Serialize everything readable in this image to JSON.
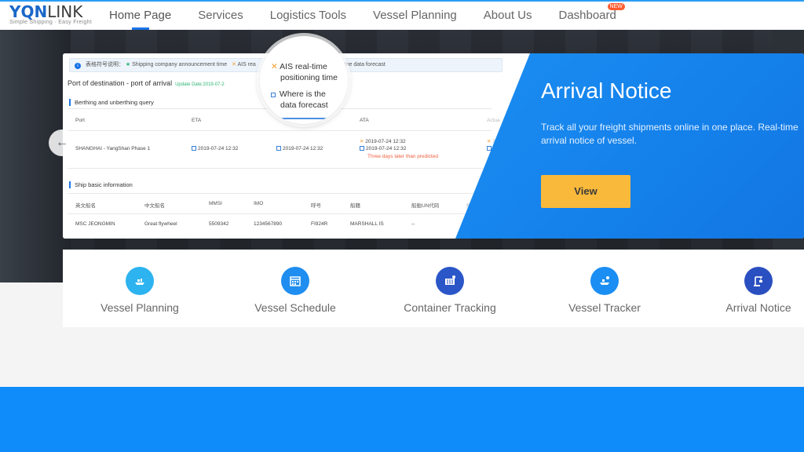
{
  "header": {
    "logo_main_a": "YQN",
    "logo_main_b": "LINK",
    "logo_sub": "Simple Shipping · Easy Freight",
    "nav": [
      {
        "label": "Home Page"
      },
      {
        "label": "Services"
      },
      {
        "label": "Logistics Tools"
      },
      {
        "label": "Vessel Planning"
      },
      {
        "label": "About Us"
      },
      {
        "label": "Dashboard",
        "badge": "NEW"
      }
    ]
  },
  "card": {
    "legend": {
      "prefix": "表格符号说明：",
      "item1": "Shipping company announcement time",
      "item2": "AIS rea",
      "item3": "here is the data forecast"
    },
    "title": "Port of destination - port of arrival",
    "update": "Update Date:2019-07-2",
    "berthing_title": "Berthing and unberthing query",
    "berth_headers": {
      "port": "Port",
      "eta": "ETA",
      "ata": "ATA",
      "actual": "Actua"
    },
    "berth_row": {
      "port": "SHANGHAI - YangShan Phase 1",
      "eta": "2019-07-24 12:32",
      "col3": "2019-07-24 12:32",
      "ata1": "2019-07-24 12:32",
      "ata2": "2019-07-24 12:32",
      "note": "Three days later than predicted",
      "more1": "2",
      "more2": "2"
    },
    "ship_title": "Ship basic information",
    "ship_headers": [
      "英文船名",
      "中文船名",
      "MMSI",
      "IMO",
      "呼号",
      "船籍",
      "船舶UN代码",
      "船"
    ],
    "ship_row": [
      "MSC JEONGMIN",
      "Great flywheel",
      "5509342",
      "1234567890",
      "FI924R",
      "MARSHALL IS",
      "--"
    ],
    "magnifier": {
      "line1": "AIS real-time",
      "line2": "positioning time",
      "line3": "Where is the",
      "line4": "data forecast"
    },
    "notice_title": "Arrival Notice",
    "notice_desc": "Track all your freight shipments online in one place. Real-time arrival notice of vessel.",
    "view_label": "View"
  },
  "features": [
    {
      "label": "Vessel Planning",
      "color": "#2cb3f0",
      "icon": "ship-icon"
    },
    {
      "label": "Vessel Schedule",
      "color": "#1f8ef0",
      "icon": "calendar-icon"
    },
    {
      "label": "Container Tracking",
      "color": "#2a56c8",
      "icon": "container-icon"
    },
    {
      "label": "Vessel Tracker",
      "color": "#1a8ef2",
      "icon": "ship-tracker-icon"
    },
    {
      "label": "Arrival Notice",
      "color": "#2a4fc0",
      "icon": "crane-icon"
    }
  ]
}
